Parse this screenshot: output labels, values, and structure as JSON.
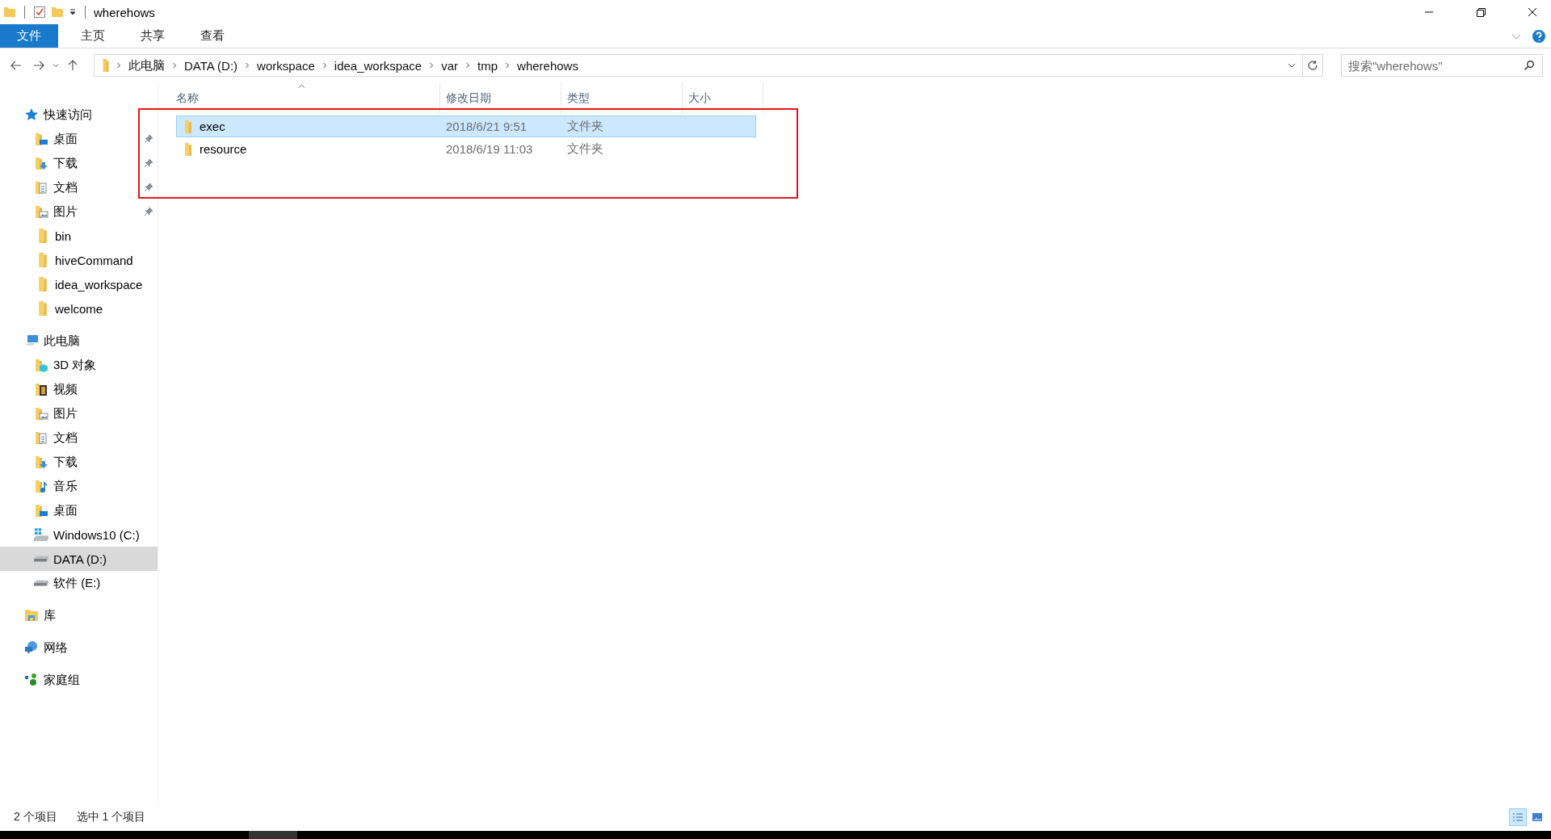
{
  "window": {
    "title": "wherehows"
  },
  "ribbon": {
    "tabs": [
      {
        "label": "文件",
        "kind": "file"
      },
      {
        "label": "主页",
        "kind": "tab"
      },
      {
        "label": "共享",
        "kind": "tab"
      },
      {
        "label": "查看",
        "kind": "tab"
      }
    ]
  },
  "address_bar": {
    "path": [
      "此电脑",
      "DATA (D:)",
      "workspace",
      "idea_workspace",
      "var",
      "tmp",
      "wherehows"
    ]
  },
  "search": {
    "placeholder": "搜索\"wherehows\""
  },
  "sidebar": {
    "items": [
      {
        "label": "快速访问",
        "kind": "star",
        "selected": false,
        "children": [
          {
            "label": "桌面",
            "kind": "desktop",
            "pinned": true,
            "selected": false
          },
          {
            "label": "下载",
            "kind": "download",
            "pinned": true,
            "selected": false
          },
          {
            "label": "文档",
            "kind": "document",
            "pinned": true,
            "selected": false
          },
          {
            "label": "图片",
            "kind": "pictures",
            "pinned": true,
            "selected": false
          },
          {
            "label": "bin",
            "kind": "folder",
            "pinned": false,
            "selected": false
          },
          {
            "label": "hiveCommand",
            "kind": "folder",
            "pinned": false,
            "selected": false
          },
          {
            "label": "idea_workspace",
            "kind": "folder",
            "pinned": false,
            "selected": false
          },
          {
            "label": "welcome",
            "kind": "folder",
            "pinned": false,
            "selected": false
          }
        ]
      },
      {
        "label": "此电脑",
        "kind": "computer",
        "selected": false,
        "children": [
          {
            "label": "3D 对象",
            "kind": "cube",
            "pinned": false,
            "selected": false
          },
          {
            "label": "视频",
            "kind": "video",
            "pinned": false,
            "selected": false
          },
          {
            "label": "图片",
            "kind": "pictures",
            "pinned": false,
            "selected": false
          },
          {
            "label": "文档",
            "kind": "document",
            "pinned": false,
            "selected": false
          },
          {
            "label": "下载",
            "kind": "download",
            "pinned": false,
            "selected": false
          },
          {
            "label": "音乐",
            "kind": "music",
            "pinned": false,
            "selected": false
          },
          {
            "label": "桌面",
            "kind": "desktop",
            "pinned": false,
            "selected": false
          },
          {
            "label": "Windows10 (C:)",
            "kind": "system-drive",
            "pinned": false,
            "selected": false
          },
          {
            "label": "DATA (D:)",
            "kind": "drive",
            "pinned": false,
            "selected": true
          },
          {
            "label": "软件 (E:)",
            "kind": "drive",
            "pinned": false,
            "selected": false
          }
        ]
      },
      {
        "label": "库",
        "kind": "library",
        "selected": false
      },
      {
        "label": "网络",
        "kind": "network",
        "selected": false
      },
      {
        "label": "家庭组",
        "kind": "homegroup",
        "selected": false
      }
    ]
  },
  "file_list": {
    "columns": [
      {
        "label": "名称",
        "sorted": true
      },
      {
        "label": "修改日期",
        "sorted": false
      },
      {
        "label": "类型",
        "sorted": false
      },
      {
        "label": "大小",
        "sorted": false
      }
    ],
    "rows": [
      {
        "name": "exec",
        "modified": "2018/6/21 9:51",
        "type": "文件夹",
        "selected": true
      },
      {
        "name": "resource",
        "modified": "2018/6/19 11:03",
        "type": "文件夹",
        "selected": false
      }
    ]
  },
  "annotations": [
    {
      "kind": "rectangle",
      "color": "#e8141b"
    }
  ],
  "status_bar": {
    "texts": [
      "2 个项目",
      "选中 1 个项目"
    ],
    "view_buttons": [
      {
        "kind": "details",
        "selected": true
      },
      {
        "kind": "tiles",
        "selected": false
      }
    ]
  }
}
